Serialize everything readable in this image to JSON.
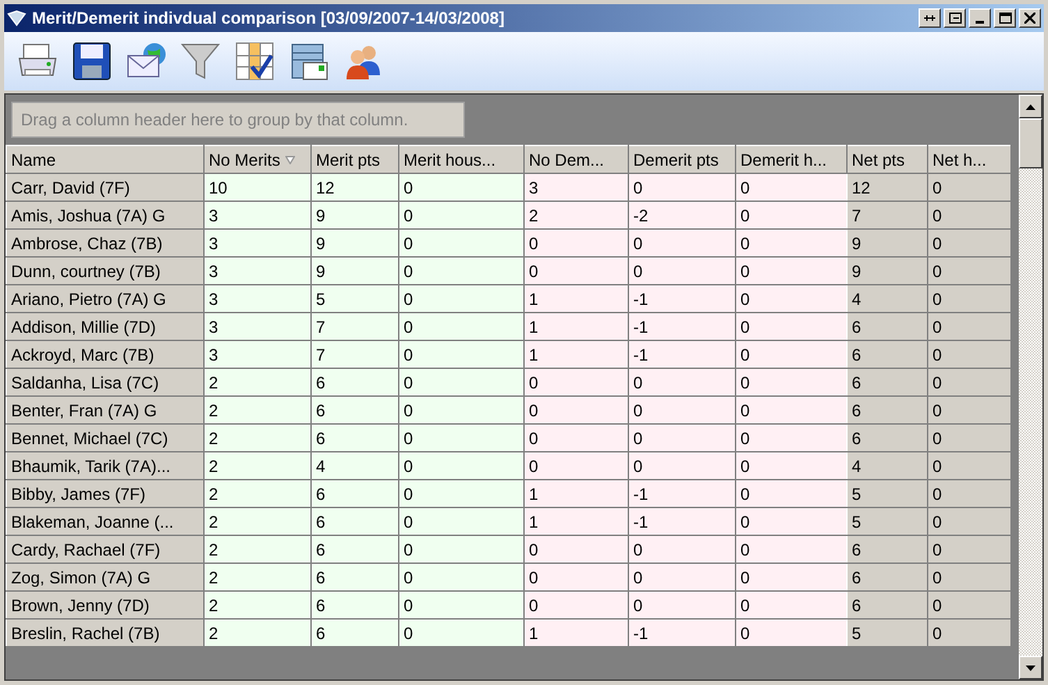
{
  "window": {
    "title": "Merit/Demerit indivdual comparison [03/09/2007-14/03/2008]"
  },
  "toolbar": [
    {
      "kind": "printer"
    },
    {
      "kind": "save"
    },
    {
      "kind": "email"
    },
    {
      "kind": "filter"
    },
    {
      "kind": "grid"
    },
    {
      "kind": "report"
    },
    {
      "kind": "people"
    }
  ],
  "group_panel": {
    "placeholder": "Drag a column header here to group by that column."
  },
  "table": {
    "columns": [
      {
        "label": "Name",
        "kind": "name",
        "sorted": false
      },
      {
        "label": "No Merits",
        "kind": "merit",
        "sorted": true
      },
      {
        "label": "Merit pts",
        "kind": "merit",
        "sorted": false
      },
      {
        "label": "Merit hous...",
        "kind": "merit",
        "sorted": false
      },
      {
        "label": "No Dem...",
        "kind": "demerit",
        "sorted": false
      },
      {
        "label": "Demerit pts",
        "kind": "demerit",
        "sorted": false
      },
      {
        "label": "Demerit h...",
        "kind": "demerit",
        "sorted": false
      },
      {
        "label": "Net pts",
        "kind": "net",
        "sorted": false
      },
      {
        "label": "Net h...",
        "kind": "net",
        "sorted": false
      }
    ],
    "rows": [
      [
        "Carr, David (7F)",
        "10",
        "12",
        "0",
        "3",
        "0",
        "0",
        "12",
        "0"
      ],
      [
        "Amis, Joshua (7A)   G",
        "3",
        "9",
        "0",
        "2",
        "-2",
        "0",
        "7",
        "0"
      ],
      [
        "Ambrose, Chaz (7B)",
        "3",
        "9",
        "0",
        "0",
        "0",
        "0",
        "9",
        "0"
      ],
      [
        "Dunn, courtney (7B)",
        "3",
        "9",
        "0",
        "0",
        "0",
        "0",
        "9",
        "0"
      ],
      [
        "Ariano, Pietro (7A)   G",
        "3",
        "5",
        "0",
        "1",
        "-1",
        "0",
        "4",
        "0"
      ],
      [
        "Addison, Millie (7D)",
        "3",
        "7",
        "0",
        "1",
        "-1",
        "0",
        "6",
        "0"
      ],
      [
        "Ackroyd, Marc (7B)",
        "3",
        "7",
        "0",
        "1",
        "-1",
        "0",
        "6",
        "0"
      ],
      [
        "Saldanha, Lisa (7C)",
        "2",
        "6",
        "0",
        "0",
        "0",
        "0",
        "6",
        "0"
      ],
      [
        "Benter, Fran (7A)   G",
        "2",
        "6",
        "0",
        "0",
        "0",
        "0",
        "6",
        "0"
      ],
      [
        "Bennet, Michael (7C)",
        "2",
        "6",
        "0",
        "0",
        "0",
        "0",
        "6",
        "0"
      ],
      [
        "Bhaumik, Tarik (7A)...",
        "2",
        "4",
        "0",
        "0",
        "0",
        "0",
        "4",
        "0"
      ],
      [
        "Bibby, James (7F)",
        "2",
        "6",
        "0",
        "1",
        "-1",
        "0",
        "5",
        "0"
      ],
      [
        "Blakeman, Joanne (...",
        "2",
        "6",
        "0",
        "1",
        "-1",
        "0",
        "5",
        "0"
      ],
      [
        "Cardy, Rachael (7F)",
        "2",
        "6",
        "0",
        "0",
        "0",
        "0",
        "6",
        "0"
      ],
      [
        "Zog, Simon (7A)   G",
        "2",
        "6",
        "0",
        "0",
        "0",
        "0",
        "6",
        "0"
      ],
      [
        "Brown, Jenny (7D)",
        "2",
        "6",
        "0",
        "0",
        "0",
        "0",
        "6",
        "0"
      ],
      [
        "Breslin, Rachel (7B)",
        "2",
        "6",
        "0",
        "1",
        "-1",
        "0",
        "5",
        "0"
      ]
    ]
  }
}
